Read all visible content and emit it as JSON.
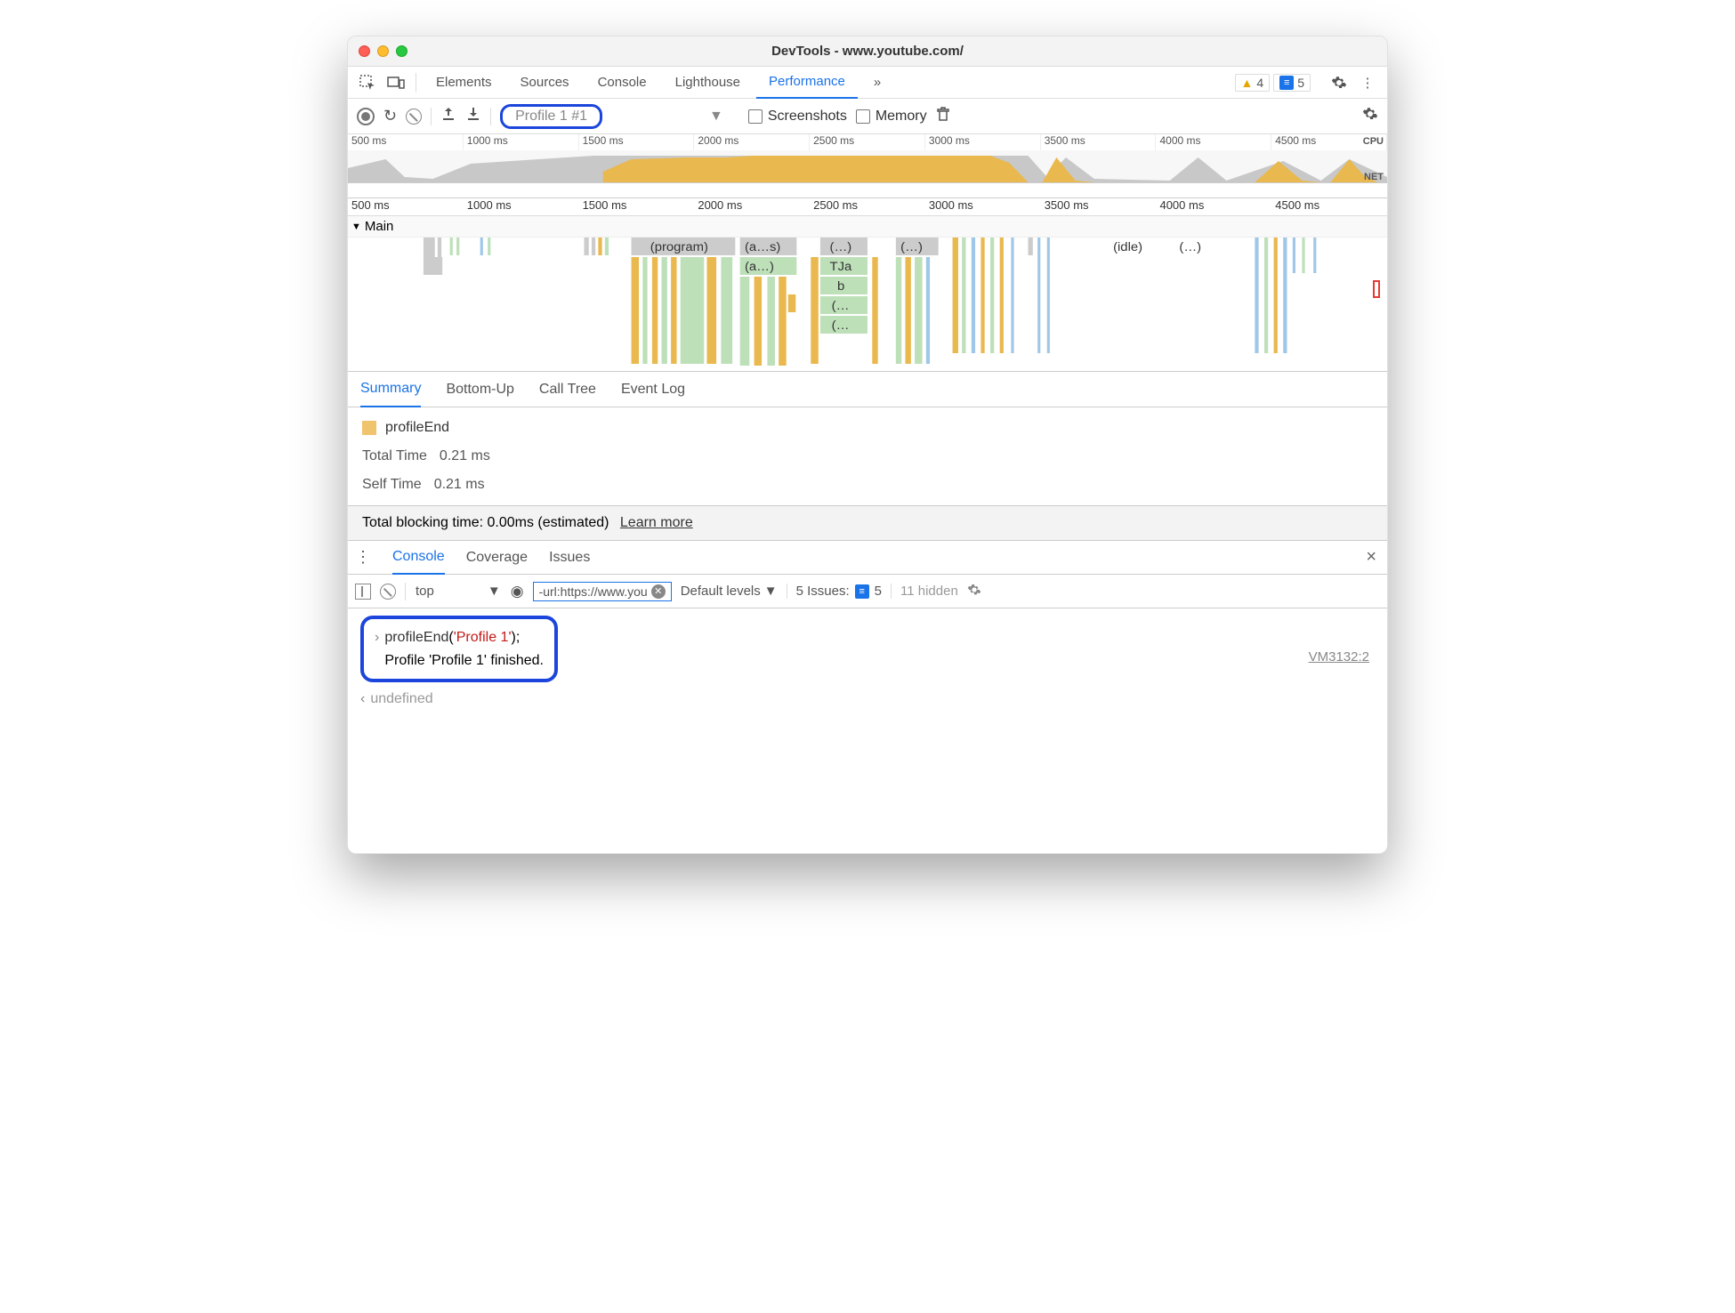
{
  "window": {
    "title": "DevTools - www.youtube.com/"
  },
  "warnings": {
    "count": "4"
  },
  "messages": {
    "count": "5"
  },
  "tabs": {
    "items": [
      "Elements",
      "Sources",
      "Console",
      "Lighthouse",
      "Performance"
    ],
    "active": "Performance",
    "more": "»"
  },
  "toolbar": {
    "profile": "Profile 1 #1",
    "screenshots": "Screenshots",
    "memory": "Memory"
  },
  "timeline": {
    "ticks": [
      "500 ms",
      "1000 ms",
      "1500 ms",
      "2000 ms",
      "2500 ms",
      "3000 ms",
      "3500 ms",
      "4000 ms",
      "4500 ms"
    ],
    "cpu_label": "CPU",
    "net_label": "NET"
  },
  "flame": {
    "main": "Main",
    "blocks": {
      "program": "(program)",
      "as": "(a…s)",
      "a": "(a…)",
      "e1": "(…)",
      "tja": "TJa",
      "b": "b",
      "e2": "(…",
      "e3": "(…",
      "e4": "(…)",
      "idle": "(idle)",
      "e5": "(…)"
    }
  },
  "subtabs": {
    "items": [
      "Summary",
      "Bottom-Up",
      "Call Tree",
      "Event Log"
    ],
    "active": "Summary"
  },
  "summary": {
    "name": "profileEnd",
    "total_label": "Total Time",
    "total_value": "0.21 ms",
    "self_label": "Self Time",
    "self_value": "0.21 ms"
  },
  "tbt": {
    "text": "Total blocking time: 0.00ms (estimated)",
    "link": "Learn more"
  },
  "drawer": {
    "items": [
      "Console",
      "Coverage",
      "Issues"
    ],
    "active": "Console"
  },
  "console_tb": {
    "context": "top",
    "filter": "-url:https://www.you",
    "levels": "Default levels",
    "issues_label": "5 Issues:",
    "issues_count": "5",
    "hidden": "11 hidden"
  },
  "console": {
    "cmd_fn": "profileEnd",
    "cmd_arg": "'Profile 1'",
    "cmd_tail": ";",
    "out": "Profile 'Profile 1' finished.",
    "src": "VM3132:2",
    "undef": "undefined"
  }
}
